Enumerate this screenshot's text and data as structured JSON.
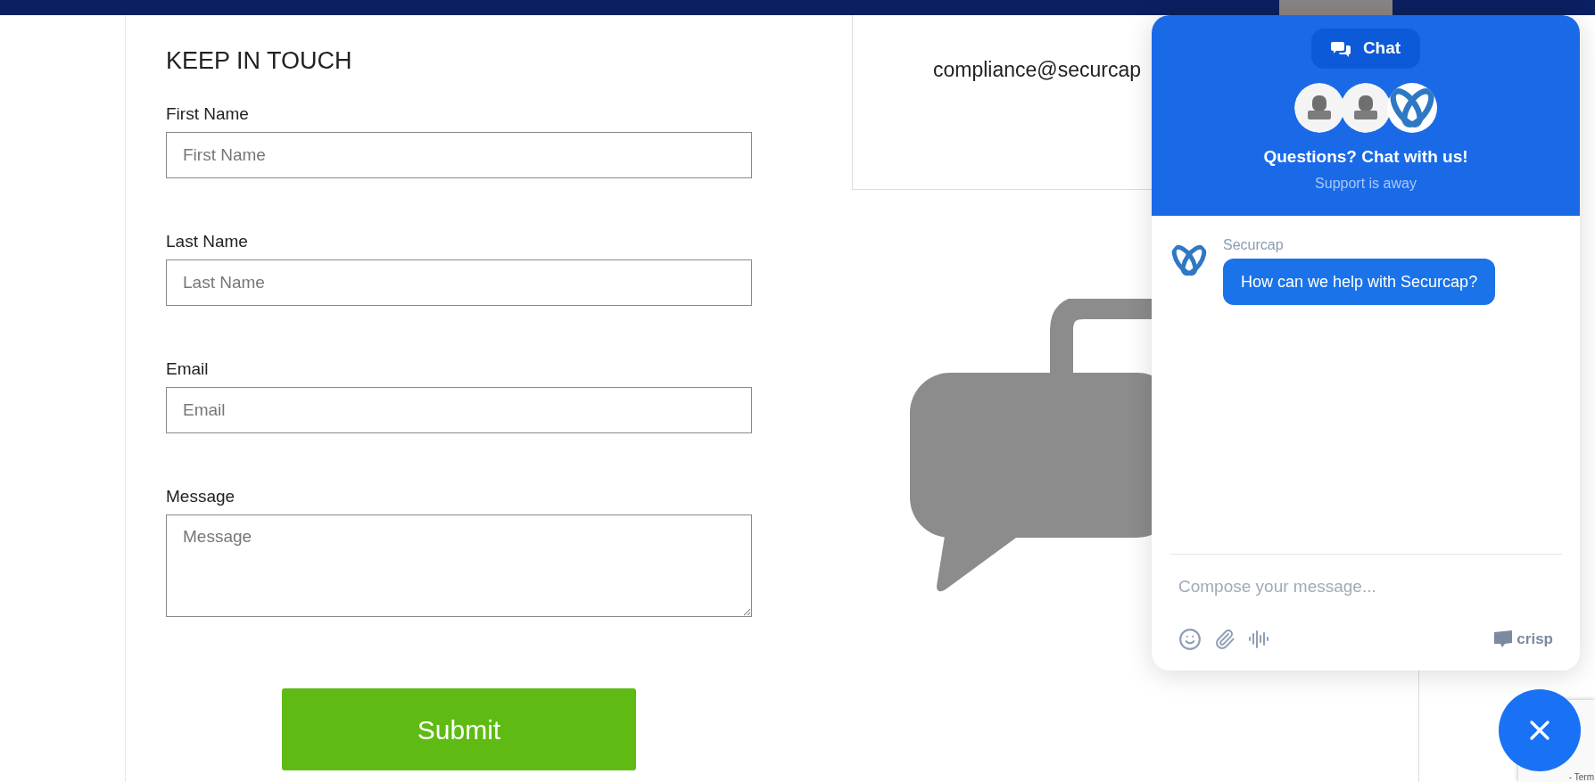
{
  "form": {
    "title": "KEEP IN TOUCH",
    "fields": [
      {
        "kind": "input",
        "label": "First Name",
        "placeholder": "First Name"
      },
      {
        "kind": "input",
        "label": "Last Name",
        "placeholder": "Last Name"
      },
      {
        "kind": "input",
        "label": "Email",
        "placeholder": "Email"
      },
      {
        "kind": "textarea",
        "label": "Message",
        "placeholder": "Message"
      }
    ],
    "submit": "Submit"
  },
  "contact_card": {
    "email": "compliance@securcap"
  },
  "chat": {
    "tab": "Chat",
    "headline": "Questions? Chat with us!",
    "status": "Support is away",
    "messages": [
      {
        "sender": "Securcap",
        "text": "How can we help with Securcap?"
      }
    ],
    "compose": {
      "placeholder": "Compose your message..."
    },
    "brand": "crisp"
  },
  "recaptcha": {
    "text": "- Term"
  }
}
